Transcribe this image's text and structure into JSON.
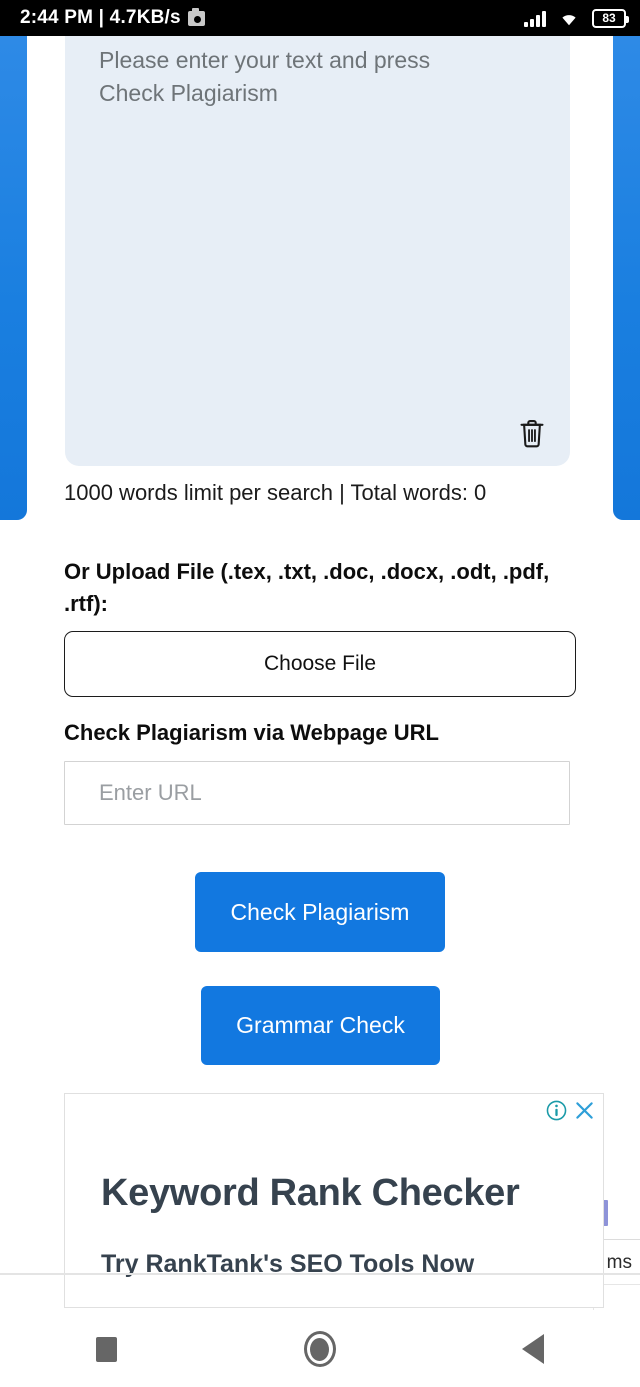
{
  "status_bar": {
    "clock": "2:44 PM | 4.7KB/s",
    "camera_icon": "camera-icon",
    "signal_icon": "cellular-signal-icon",
    "wifi_icon": "wifi-icon",
    "battery_level": "83"
  },
  "editor": {
    "placeholder": "Please enter your text and press Check Plagiarism",
    "value": "",
    "clear_icon": "trash-icon",
    "word_limit_text": "1000 words limit per search | Total words: 0"
  },
  "upload": {
    "label": "Or Upload File (.tex, .txt, .doc, .docx, .odt, .pdf, .rtf):",
    "choose_file_label": "Choose File"
  },
  "url_section": {
    "heading": "Check Plagiarism via Webpage URL",
    "placeholder": "Enter URL",
    "value": ""
  },
  "actions": {
    "check_plagiarism_label": "Check Plagiarism",
    "grammar_check_label": "Grammar Check"
  },
  "ad": {
    "headline": "Keyword Rank Checker",
    "subline": "Try RankTank's SEO Tools Now",
    "info_icon": "adchoices-info-icon",
    "close_icon": "close-icon"
  },
  "background_remnant": {
    "partial_text": "ms"
  },
  "nav_bar": {
    "recents_icon": "square-recents-icon",
    "home_icon": "circle-home-icon",
    "back_icon": "triangle-back-icon"
  },
  "colors": {
    "accent_blue": "#1278e0",
    "strip_blue": "#1a7fe0",
    "editor_bg": "#e7eef6",
    "ad_text": "#36424e",
    "adchoices_teal": "#1a9aa8",
    "close_blue": "#2e9fd8"
  }
}
